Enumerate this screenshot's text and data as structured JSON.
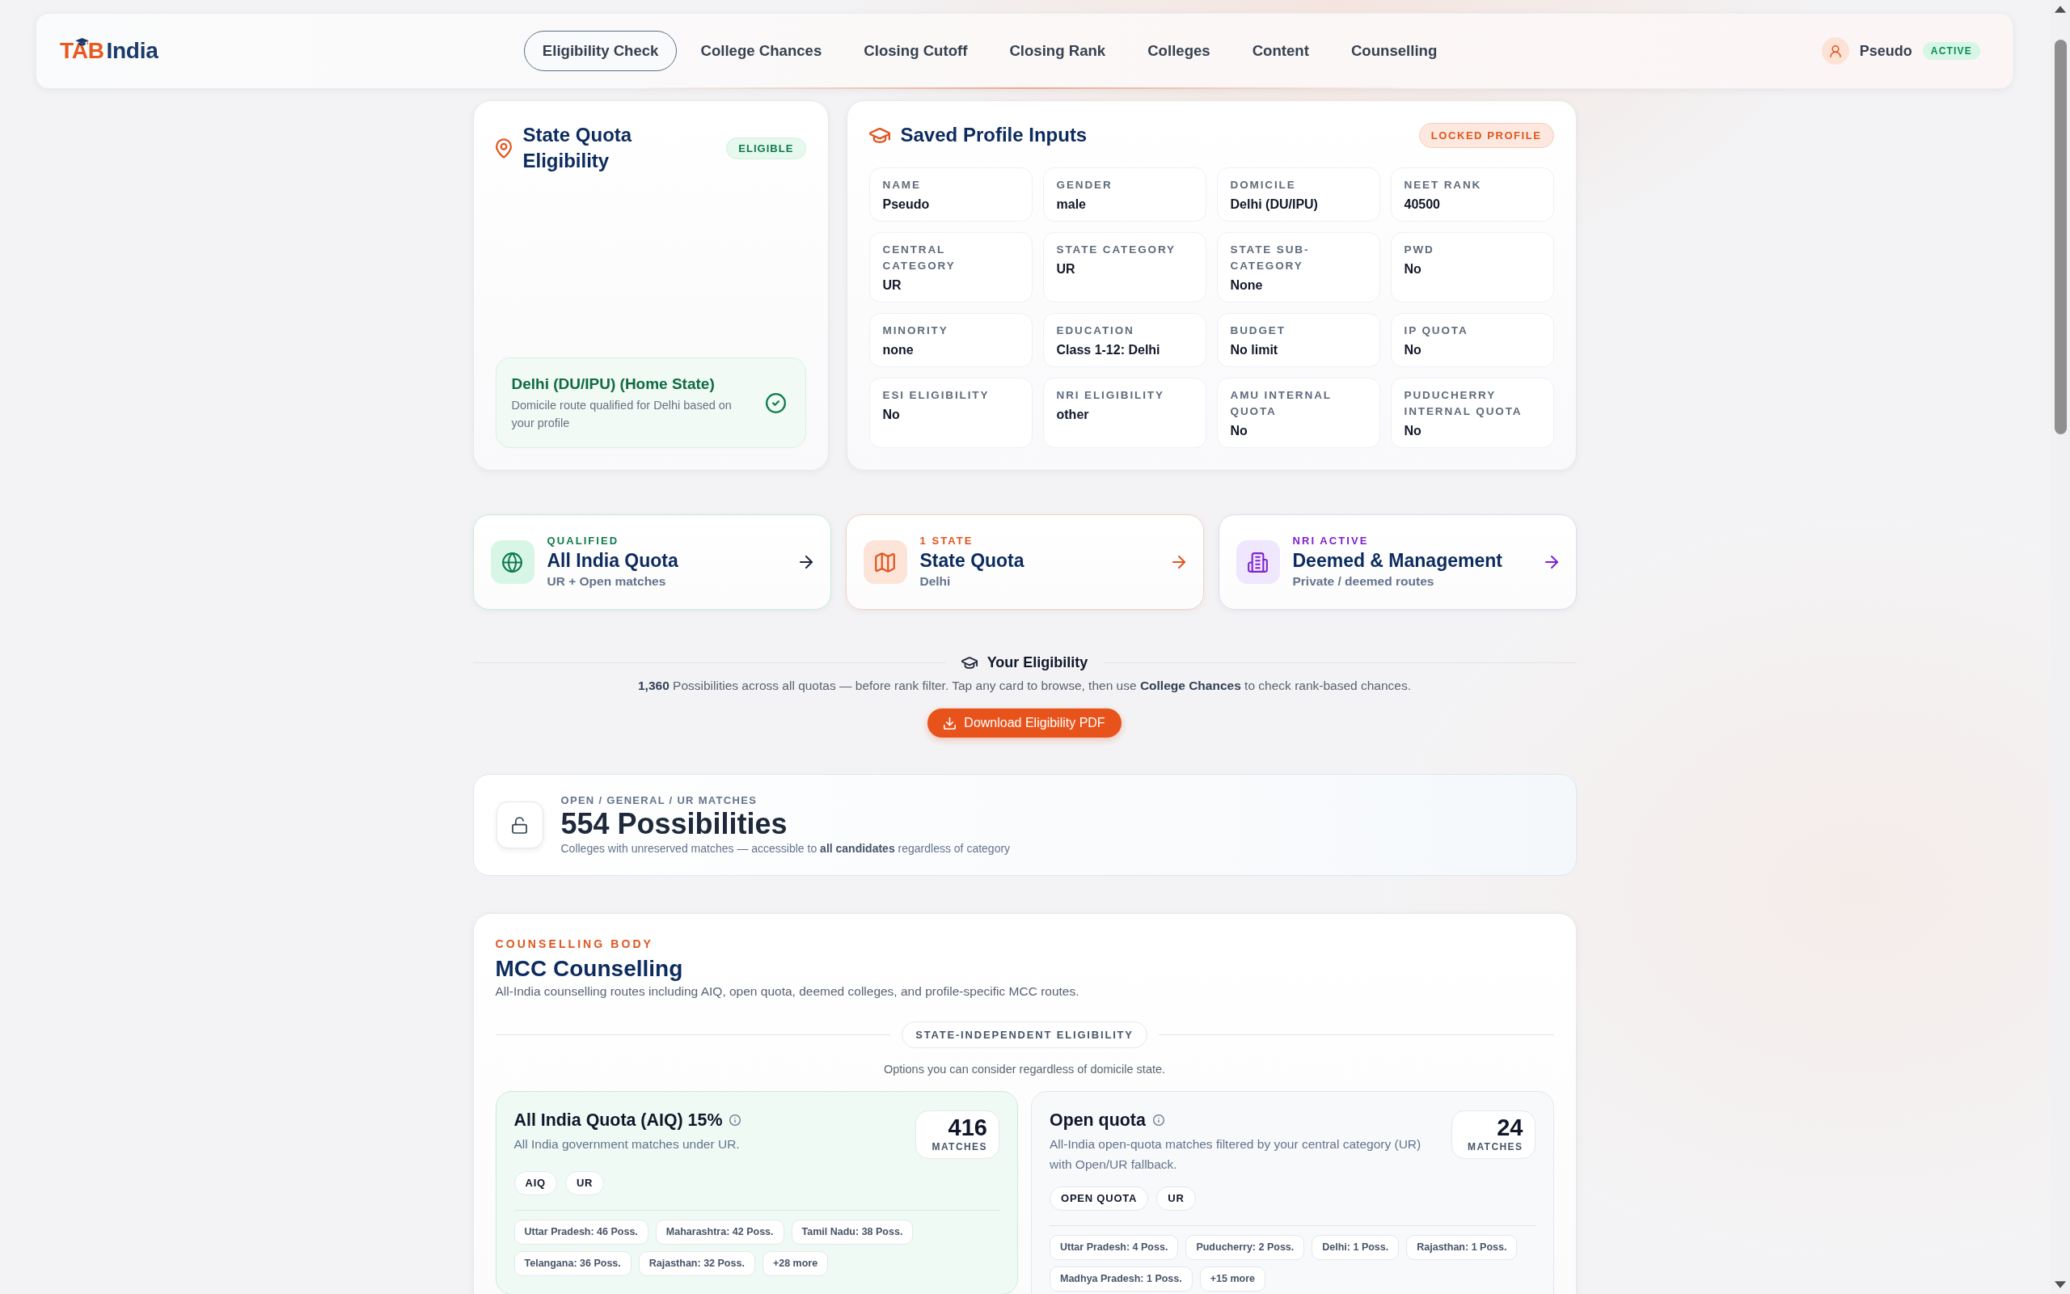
{
  "header": {
    "logo": {
      "accent": "TAB",
      "rest": "India"
    },
    "nav": [
      {
        "label": "Eligibility Check",
        "selected": true
      },
      {
        "label": "College Chances",
        "selected": false
      },
      {
        "label": "Closing Cutoff",
        "selected": false
      },
      {
        "label": "Closing Rank",
        "selected": false
      },
      {
        "label": "Colleges",
        "selected": false
      },
      {
        "label": "Content",
        "selected": false
      },
      {
        "label": "Counselling",
        "selected": false
      }
    ],
    "user": {
      "name": "Pseudo",
      "status": "ACTIVE"
    }
  },
  "state_quota": {
    "title": "State Quota Eligibility",
    "badge": "ELIGIBLE",
    "home_state": {
      "title": "Delhi (DU/IPU) (Home State)",
      "description": "Domicile route qualified for Delhi based on your profile"
    }
  },
  "profile": {
    "title": "Saved Profile Inputs",
    "badge": "LOCKED PROFILE",
    "fields": [
      {
        "label": "NAME",
        "value": "Pseudo"
      },
      {
        "label": "GENDER",
        "value": "male"
      },
      {
        "label": "DOMICILE",
        "value": "Delhi (DU/IPU)"
      },
      {
        "label": "NEET RANK",
        "value": "40500"
      },
      {
        "label": "CENTRAL CATEGORY",
        "value": "UR"
      },
      {
        "label": "STATE CATEGORY",
        "value": "UR"
      },
      {
        "label": "STATE SUB-CATEGORY",
        "value": "None"
      },
      {
        "label": "PWD",
        "value": "No"
      },
      {
        "label": "MINORITY",
        "value": "none"
      },
      {
        "label": "EDUCATION",
        "value": "Class 1-12: Delhi"
      },
      {
        "label": "BUDGET",
        "value": "No limit"
      },
      {
        "label": "IP QUOTA",
        "value": "No"
      },
      {
        "label": "ESI ELIGIBILITY",
        "value": "No"
      },
      {
        "label": "NRI ELIGIBILITY",
        "value": "other"
      },
      {
        "label": "AMU INTERNAL QUOTA",
        "value": "No"
      },
      {
        "label": "PUDUCHERRY INTERNAL QUOTA",
        "value": "No"
      }
    ]
  },
  "quota_cards": [
    {
      "kind": "all_india",
      "status": "QUALIFIED",
      "color": "#0f7a4c",
      "title": "All India Quota",
      "subtitle": "UR + Open matches"
    },
    {
      "kind": "state",
      "status": "1 STATE",
      "color": "#e0561f",
      "title": "State Quota",
      "subtitle": "Delhi"
    },
    {
      "kind": "deemed",
      "status": "NRI ACTIVE",
      "color": "#7e22ce",
      "title": "Deemed & Management",
      "subtitle": "Private / deemed routes"
    }
  ],
  "eligibility": {
    "title": "Your Eligibility",
    "text": "**1,360** Possibilities across all quotas — before rank filter. Tap any card to browse, then use **College Chances** to check rank-based chances.",
    "button": "Download Eligibility PDF"
  },
  "open_matches": {
    "label": "OPEN / GENERAL / UR MATCHES",
    "title": "554 Possibilities",
    "description": "Colleges with unreserved matches — accessible to **all candidates** regardless of category"
  },
  "counselling": {
    "eyebrow": "COUNSELLING BODY",
    "title": "MCC Counselling",
    "description": "All-India counselling routes including AIQ, open quota, deemed colleges, and profile-specific MCC routes.",
    "section": {
      "label": "STATE-INDEPENDENT ELIGIBILITY",
      "note": "Options you can consider regardless of domicile state."
    },
    "routes": [
      {
        "title": "All India Quota (AIQ) 15%",
        "description": "All India government matches under UR.",
        "count": "416",
        "count_label": "MATCHES",
        "highlighted": true,
        "tags": [
          "AIQ",
          "UR"
        ],
        "states": [
          "Uttar Pradesh: 46 Poss.",
          "Maharashtra: 42 Poss.",
          "Tamil Nadu: 38 Poss.",
          "Telangana: 36 Poss.",
          "Rajasthan: 32 Poss."
        ],
        "more": "+28 more"
      },
      {
        "title": "Open quota",
        "description": "All-India open-quota matches filtered by your central category (UR) with Open/UR fallback.",
        "count": "24",
        "count_label": "MATCHES",
        "highlighted": false,
        "tags": [
          "OPEN QUOTA",
          "UR"
        ],
        "states": [
          "Uttar Pradesh: 4 Poss.",
          "Puducherry: 2 Poss.",
          "Delhi: 1 Poss.",
          "Rajasthan: 1 Poss.",
          "Madhya Pradesh: 1 Poss."
        ],
        "more": "+15 more"
      }
    ]
  }
}
